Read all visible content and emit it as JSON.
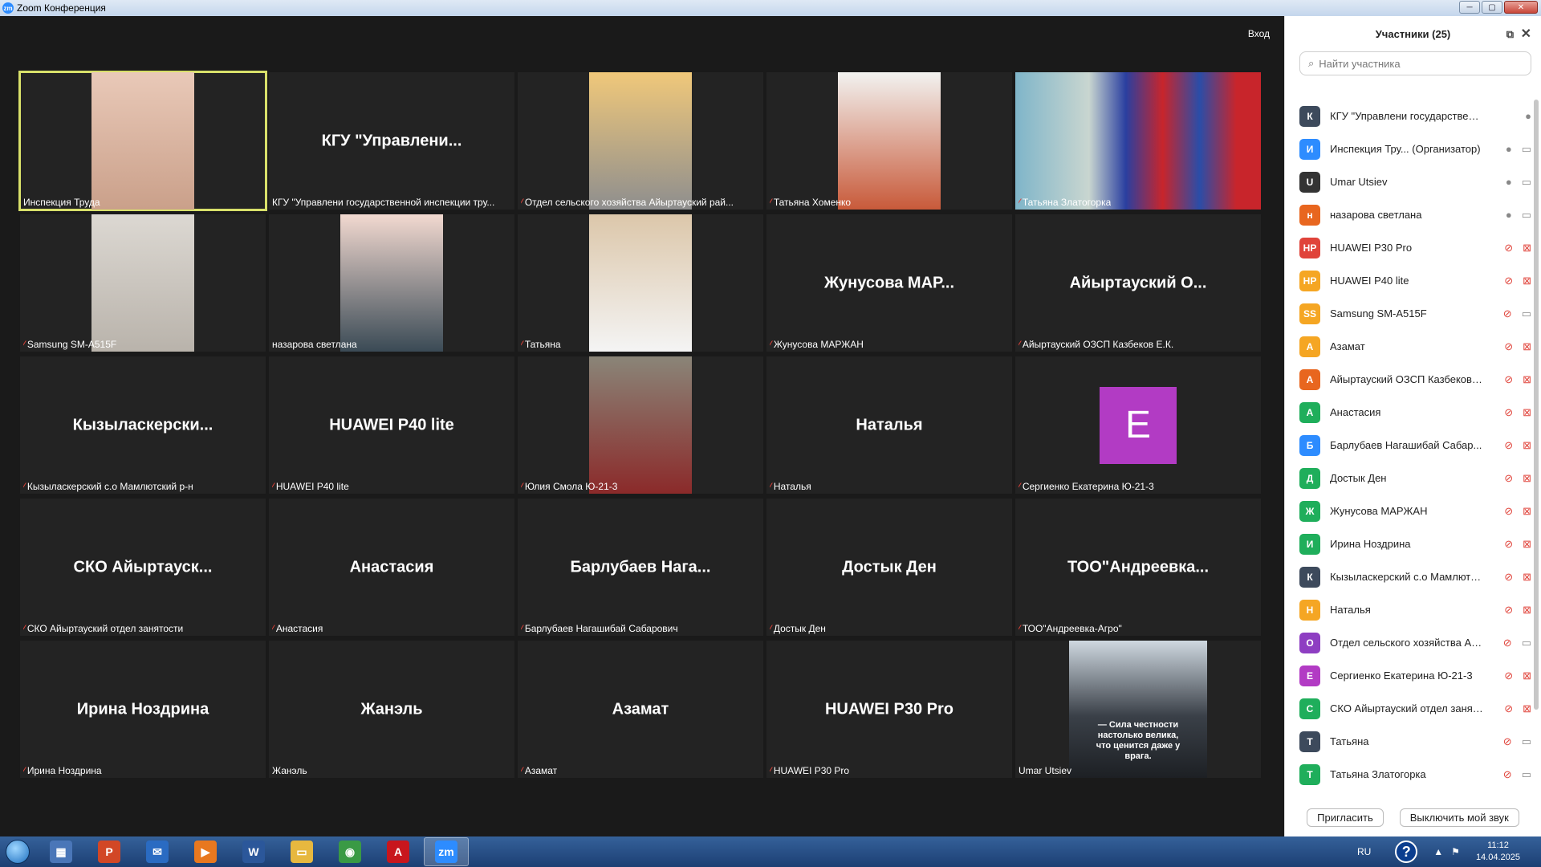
{
  "window": {
    "title": "Zoom Конференция",
    "logo": "zm"
  },
  "stage": {
    "enter_label": "Вход"
  },
  "tiles": [
    {
      "big": "",
      "label": "Инспекция Труда",
      "muted": false
    },
    {
      "big": "КГУ \"Управлени...",
      "label": "КГУ \"Управлени государственной инспекции тру...",
      "muted": false
    },
    {
      "big": "",
      "label": "Отдел сельского хозяйства Айыртауский рай...",
      "muted": true
    },
    {
      "big": "",
      "label": "Татьяна Хоменко",
      "muted": true
    },
    {
      "big": "",
      "label": "Татьяна Златогорка",
      "muted": true
    },
    {
      "big": "",
      "label": "Samsung SM-A515F",
      "muted": true
    },
    {
      "big": "",
      "label": "назарова светлана",
      "muted": false
    },
    {
      "big": "",
      "label": "Татьяна",
      "muted": true
    },
    {
      "big": "Жунусова МАР...",
      "label": "Жунусова МАРЖАН",
      "muted": true
    },
    {
      "big": "Айыртауский О...",
      "label": "Айыртауский ОЗСП Казбеков Е.К.",
      "muted": true
    },
    {
      "big": "Кызыласкерски...",
      "label": "Кызыласкерский с.о Мамлютский р-н",
      "muted": true
    },
    {
      "big": "HUAWEI P40 lite",
      "label": "HUAWEI P40 lite",
      "muted": true
    },
    {
      "big": "",
      "label": "Юлия Смола Ю-21-3",
      "muted": true
    },
    {
      "big": "Наталья",
      "label": "Наталья",
      "muted": true
    },
    {
      "big": "",
      "label": "Сергиенко Екатерина Ю-21-3",
      "muted": true,
      "avatar": "E"
    },
    {
      "big": "СКО Айыртауск...",
      "label": "СКО Айыртауский отдел занятости",
      "muted": true
    },
    {
      "big": "Анастасия",
      "label": "Анастасия",
      "muted": true
    },
    {
      "big": "Барлубаев Нага...",
      "label": "Барлубаев Нагашибай Сабарович",
      "muted": true
    },
    {
      "big": "Достык Ден",
      "label": "Достык Ден",
      "muted": true
    },
    {
      "big": "ТОО\"Андреевка...",
      "label": "ТОО\"Андреевка-Агро\"",
      "muted": true
    },
    {
      "big": "Ирина Ноздрина",
      "label": "Ирина Ноздрина",
      "muted": true
    },
    {
      "big": "Жанэль",
      "label": "Жанэль",
      "muted": false
    },
    {
      "big": "Азамат",
      "label": "Азамат",
      "muted": true
    },
    {
      "big": "HUAWEI P30 Pro",
      "label": "HUAWEI P30 Pro",
      "muted": true
    },
    {
      "big": "",
      "label": "Umar Utsiev",
      "muted": false,
      "quote": "— Сила честности настолько велика, что ценится даже у врага."
    }
  ],
  "panel": {
    "title": "Участники (25)",
    "search_placeholder": "Найти участника",
    "participants": [
      {
        "initial": "К",
        "color": "#3d4a5c",
        "name": "КГУ \"Управлени государственн... (Я)",
        "mic": "on",
        "cam": "none"
      },
      {
        "initial": "И",
        "color": "#2d8cff",
        "name": "Инспекция Тру... (Организатор)",
        "mic": "on",
        "cam": "on"
      },
      {
        "initial": "U",
        "color": "#333333",
        "name": "Umar Utsiev",
        "mic": "on",
        "cam": "on"
      },
      {
        "initial": "н",
        "color": "#e8661f",
        "name": "назарова светлана",
        "mic": "on",
        "cam": "on"
      },
      {
        "initial": "HP",
        "color": "#e0433a",
        "name": "HUAWEI P30 Pro",
        "mic": "off",
        "cam": "off"
      },
      {
        "initial": "HP",
        "color": "#f5a623",
        "name": "HUAWEI P40 lite",
        "mic": "off",
        "cam": "off"
      },
      {
        "initial": "SS",
        "color": "#f5a623",
        "name": "Samsung SM-A515F",
        "mic": "off",
        "cam": "on"
      },
      {
        "initial": "А",
        "color": "#f5a623",
        "name": "Азамат",
        "mic": "off",
        "cam": "off"
      },
      {
        "initial": "А",
        "color": "#e8661f",
        "name": "Айыртауский ОЗСП Казбеков ...",
        "mic": "off",
        "cam": "off"
      },
      {
        "initial": "А",
        "color": "#1fae5b",
        "name": "Анастасия",
        "mic": "off",
        "cam": "off"
      },
      {
        "initial": "Б",
        "color": "#2d8cff",
        "name": "Барлубаев Нагашибай Сабар...",
        "mic": "off",
        "cam": "off"
      },
      {
        "initial": "Д",
        "color": "#1fae5b",
        "name": "Достык Ден",
        "mic": "off",
        "cam": "off"
      },
      {
        "initial": "Ж",
        "color": "#1fae5b",
        "name": "Жунусова МАРЖАН",
        "mic": "off",
        "cam": "off"
      },
      {
        "initial": "И",
        "color": "#1fae5b",
        "name": "Ирина Ноздрина",
        "mic": "off",
        "cam": "off"
      },
      {
        "initial": "К",
        "color": "#3d4a5c",
        "name": "Кызыласкерский с.о Мамлютс...",
        "mic": "off",
        "cam": "off"
      },
      {
        "initial": "Н",
        "color": "#f5a623",
        "name": "Наталья",
        "mic": "off",
        "cam": "off"
      },
      {
        "initial": "О",
        "color": "#8e3ec2",
        "name": "Отдел сельского хозяйства Ай...",
        "mic": "off",
        "cam": "on"
      },
      {
        "initial": "Е",
        "color": "#b23bc4",
        "name": "Сергиенко Екатерина Ю-21-3",
        "mic": "off",
        "cam": "off"
      },
      {
        "initial": "С",
        "color": "#1fae5b",
        "name": "СКО Айыртауский отдел занят...",
        "mic": "off",
        "cam": "off"
      },
      {
        "initial": "Т",
        "color": "#3d4a5c",
        "name": "Татьяна",
        "mic": "off",
        "cam": "on"
      },
      {
        "initial": "Т",
        "color": "#1fae5b",
        "name": "Татьяна Златогорка",
        "mic": "off",
        "cam": "on"
      }
    ],
    "invite_label": "Пригласить",
    "mute_all_label": "Выключить мой звук"
  },
  "taskbar": {
    "apps": [
      {
        "icon": "calculator-icon",
        "color": "#4a76b8",
        "glyph": "▦"
      },
      {
        "icon": "powerpoint-icon",
        "color": "#d24726",
        "glyph": "P"
      },
      {
        "icon": "outlook-icon",
        "color": "#2a6bc2",
        "glyph": "✉"
      },
      {
        "icon": "media-player-icon",
        "color": "#e8781f",
        "glyph": "▶"
      },
      {
        "icon": "word-icon",
        "color": "#2b579a",
        "glyph": "W"
      },
      {
        "icon": "explorer-icon",
        "color": "#e7b83f",
        "glyph": "▭"
      },
      {
        "icon": "chrome-icon",
        "color": "#3a9a45",
        "glyph": "◉"
      },
      {
        "icon": "acrobat-icon",
        "color": "#c8161d",
        "glyph": "A"
      },
      {
        "icon": "zoom-icon",
        "color": "#2d8cff",
        "glyph": "zm"
      }
    ],
    "lang": "RU",
    "time": "11:12",
    "date": "14.04.2025"
  }
}
